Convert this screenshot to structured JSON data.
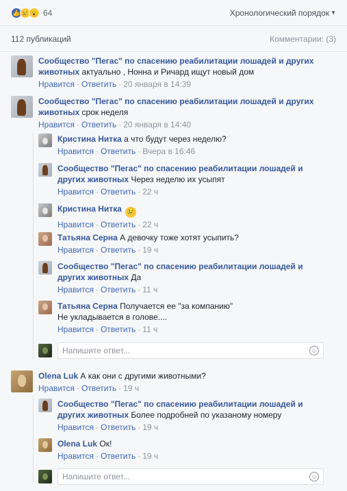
{
  "header": {
    "reactions": [
      {
        "icon": "like-icon",
        "glyph": "👍"
      },
      {
        "icon": "sad-icon",
        "glyph": "😢"
      },
      {
        "icon": "wow-icon",
        "glyph": "😮"
      }
    ],
    "reaction_count": "64",
    "sort_label": "Хронологический порядок"
  },
  "stats": {
    "publications": "112 публикаций",
    "comments": "Комментарии: (3)"
  },
  "actions": {
    "like": "Нравится",
    "reply": "Ответить"
  },
  "comments": [
    {
      "author": "Сообщество \"Пегас\" по спасению реабилитации лошадей и других животных",
      "text": "актуально , Нонна и Ричард ищут новый дом",
      "time": "20 января в 14:39"
    },
    {
      "author": "Сообщество \"Пегас\" по спасению реабилитации лошадей и других животных",
      "text": "срок неделя",
      "time": "20 января в 14:40",
      "replies": [
        {
          "author": "Кристина Нитка",
          "text": "а что будут через неделю?",
          "time": "Вчера в 16:46"
        },
        {
          "author": "Сообщество \"Пегас\" по спасению реабилитации лошадей и других животных",
          "text": "Через неделю их усыпят",
          "time": "22 ч"
        },
        {
          "author": "Кристина Нитка",
          "text": "",
          "time": "22 ч",
          "emoji": "😢"
        },
        {
          "author": "Татьяна Серна",
          "text": "А девочку тоже хотят усыпить?",
          "time": "19 ч"
        },
        {
          "author": "Сообщество \"Пегас\" по спасению реабилитации лошадей и других животных",
          "text": "Да",
          "time": "11 ч"
        },
        {
          "author": "Татьяна Серна",
          "text": "Получается ее \"за компанию\"",
          "text2": "Не укладывается в голове....",
          "time": "11 ч"
        }
      ]
    },
    {
      "author": "Olena Luk",
      "text": "А как они с другими животными?",
      "time": "19 ч",
      "replies": [
        {
          "author": "Сообщество \"Пегас\" по спасению реабилитации лошадей и других животных",
          "text": "Более подробней по указаному номеру",
          "time": "19 ч"
        },
        {
          "author": "Olena Luk",
          "text": "Ок!",
          "time": "19 ч"
        }
      ]
    }
  ],
  "reply_input": {
    "placeholder": "Напишите ответ..."
  }
}
